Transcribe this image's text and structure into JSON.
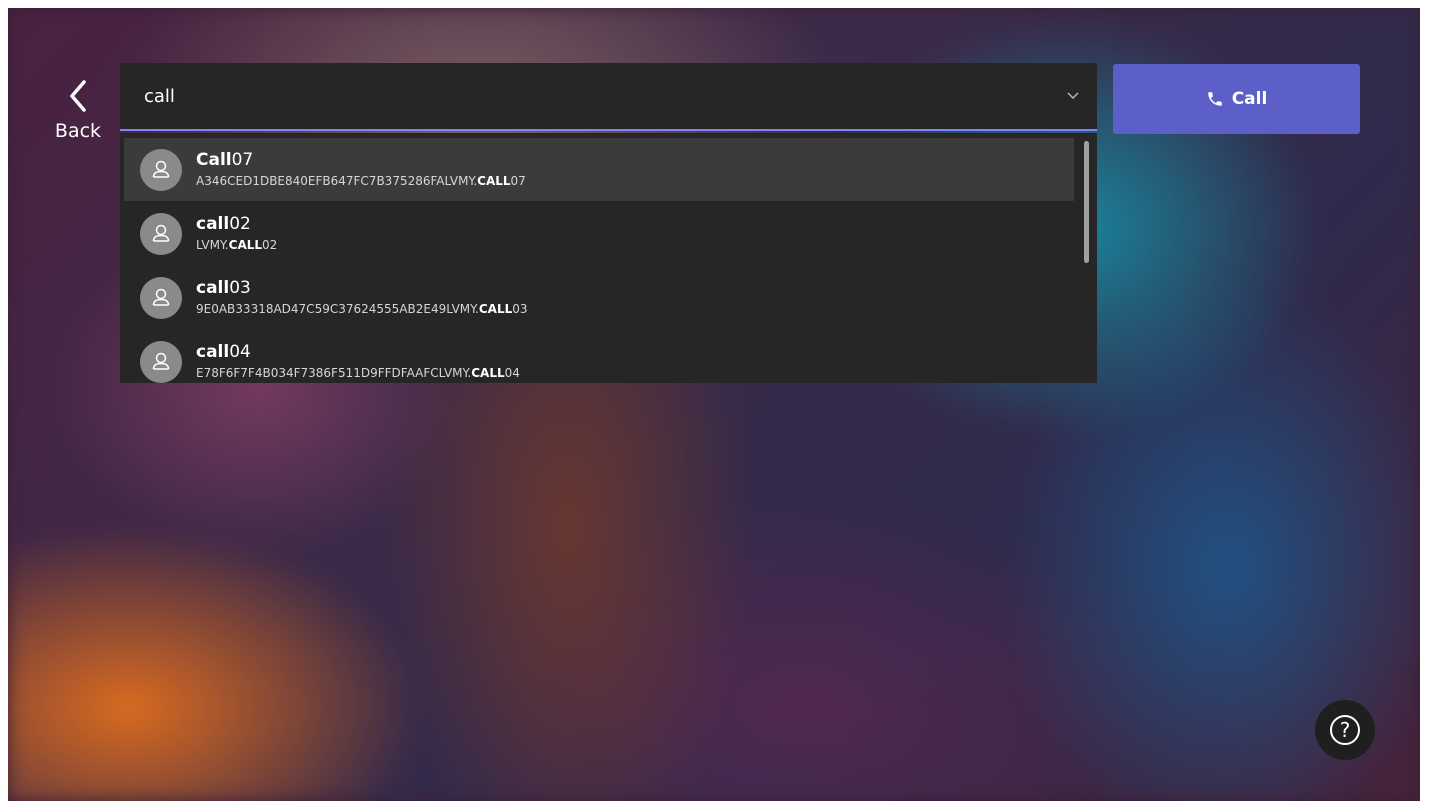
{
  "back": {
    "label": "Back",
    "icon": "chevron-left-icon"
  },
  "search": {
    "value": "call",
    "placeholder": ""
  },
  "call_button": {
    "label": "Call",
    "icon": "phone-icon"
  },
  "results": [
    {
      "name_match": "Call",
      "name_rest": "07",
      "sub_pre": "A346CED1DBE840EFB647FC7B375286FALVMY.",
      "sub_match": "CALL",
      "sub_post": "07",
      "selected": true
    },
    {
      "name_match": "call",
      "name_rest": "02",
      "sub_pre": "LVMY.",
      "sub_match": "CALL",
      "sub_post": "02",
      "selected": false
    },
    {
      "name_match": "call",
      "name_rest": "03",
      "sub_pre": "9E0AB33318AD47C59C37624555AB2E49LVMY.",
      "sub_match": "CALL",
      "sub_post": "03",
      "selected": false
    },
    {
      "name_match": "call",
      "name_rest": "04",
      "sub_pre": "E78F6F7F4B034F7386F511D9FFDFAAFCLVMY.",
      "sub_match": "CALL",
      "sub_post": "04",
      "selected": false
    }
  ],
  "help": {
    "glyph": "?",
    "icon": "help-icon"
  },
  "colors": {
    "accent": "#5b5fc7",
    "underline": "#7f85f5",
    "panel": "#262626"
  }
}
